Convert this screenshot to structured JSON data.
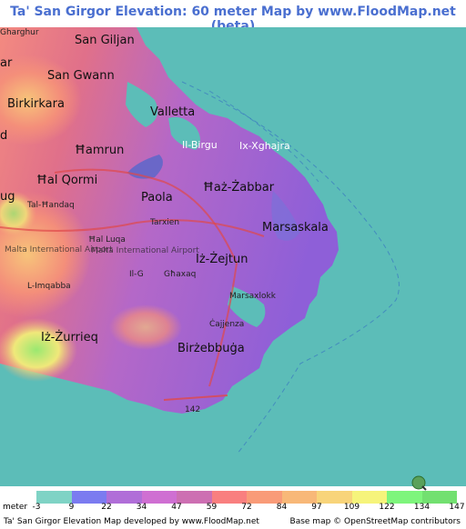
{
  "header": {
    "title": "Ta' San Girgor Elevation: 60 meter Map by www.FloodMap.net (beta)"
  },
  "map": {
    "places": [
      {
        "id": "gharghur",
        "label": "Gharghur"
      },
      {
        "id": "san-giljan",
        "label": "San Giljan"
      },
      {
        "id": "san-gwann",
        "label": "San Gwann"
      },
      {
        "id": "birkirkara",
        "label": "Birkirkara"
      },
      {
        "id": "valletta",
        "label": "Valletta"
      },
      {
        "id": "il-birgu",
        "label": "Il-Birgu"
      },
      {
        "id": "ix-xghajra",
        "label": "Ix-Xghajra"
      },
      {
        "id": "hamrun",
        "label": "Ħamrun"
      },
      {
        "id": "hal-qormi",
        "label": "Ħal Qormi"
      },
      {
        "id": "haz-zabbar",
        "label": "Ħaż-Żabbar"
      },
      {
        "id": "paola",
        "label": "Paola"
      },
      {
        "id": "tal-handaq",
        "label": "Tal-Ħandaq"
      },
      {
        "id": "tarxien",
        "label": "Tarxien"
      },
      {
        "id": "marsaskala",
        "label": "Marsaskala"
      },
      {
        "id": "hal-luqa",
        "label": "Ħal Luqa"
      },
      {
        "id": "iz-zejtun",
        "label": "Iż-Żejtun"
      },
      {
        "id": "malta-airport-1",
        "label": "Malta International Airport"
      },
      {
        "id": "malta-airport-2",
        "label": "Malta International Airport"
      },
      {
        "id": "ghaxaq",
        "label": "Għaxaq"
      },
      {
        "id": "il-g",
        "label": "Il-G"
      },
      {
        "id": "l-imqabba",
        "label": "L-Imqabba"
      },
      {
        "id": "marsaxlokk",
        "label": "Marsaxlokk"
      },
      {
        "id": "kalafrana",
        "label": "Ċajjenza"
      },
      {
        "id": "iz-zurrieq",
        "label": "Iż-Żurrieq"
      },
      {
        "id": "birzebbuga",
        "label": "Birżebbuġa"
      },
      {
        "id": "road-142",
        "label": "142"
      },
      {
        "id": "left-edge-d",
        "label": "d"
      },
      {
        "id": "left-edge-g",
        "label": "ug"
      },
      {
        "id": "left-edge-ar",
        "label": "ar"
      }
    ]
  },
  "legend": {
    "unit": "meter",
    "ticks": [
      "-3",
      "9",
      "22",
      "34",
      "47",
      "59",
      "72",
      "84",
      "97",
      "109",
      "122",
      "134",
      "147"
    ],
    "colors": [
      "#7fd3c5",
      "#7b7bf0",
      "#b06ed8",
      "#cf6fd2",
      "#cd6fb2",
      "#f97f7f",
      "#f99b78",
      "#f8b878",
      "#f8d47a",
      "#f6f47b",
      "#7ef57c",
      "#72e070"
    ]
  },
  "footer": {
    "left": "Ta' San Girgor Elevation Map developed by www.FloodMap.net",
    "right": "Base map © OpenStreetMap contributors"
  },
  "osm_badge": {
    "label": "OpenStreetMap"
  },
  "colors": {
    "sea": "#5cbdb8",
    "title": "#4a6fd0"
  }
}
